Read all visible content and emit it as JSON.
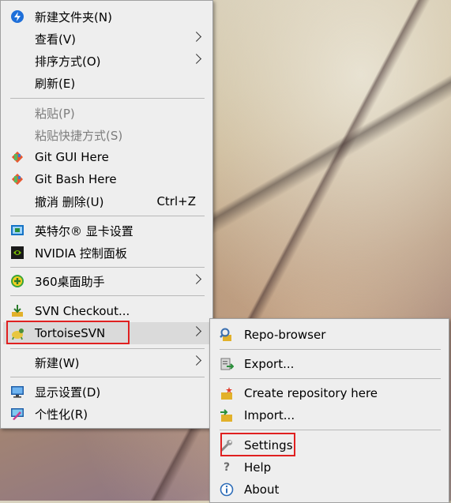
{
  "context_menu": {
    "items": [
      {
        "label": "新建文件夹(N)",
        "icon": "blue-arrow-icon"
      },
      {
        "label": "查看(V)",
        "submenu": true
      },
      {
        "label": "排序方式(O)",
        "submenu": true
      },
      {
        "label": "刷新(E)"
      },
      {
        "label": "粘贴(P)",
        "disabled": true
      },
      {
        "label": "粘贴快捷方式(S)",
        "disabled": true
      },
      {
        "label": "Git GUI Here",
        "icon": "git-icon"
      },
      {
        "label": "Git Bash Here",
        "icon": "git-icon"
      },
      {
        "label": "撤消 删除(U)",
        "shortcut": "Ctrl+Z"
      },
      {
        "label": "英特尔® 显卡设置",
        "icon": "intel-graphics-icon"
      },
      {
        "label": "NVIDIA 控制面板",
        "icon": "nvidia-icon"
      },
      {
        "label": "360桌面助手",
        "icon": "360-icon",
        "submenu": true
      },
      {
        "label": "SVN Checkout...",
        "icon": "svn-checkout-icon"
      },
      {
        "label": "TortoiseSVN",
        "icon": "tortoisesvn-icon",
        "submenu": true
      },
      {
        "label": "新建(W)",
        "submenu": true
      },
      {
        "label": "显示设置(D)",
        "icon": "display-settings-icon"
      },
      {
        "label": "个性化(R)",
        "icon": "personalize-icon"
      }
    ]
  },
  "tortoise_submenu": {
    "items": [
      {
        "label": "Repo-browser",
        "icon": "repo-browser-icon"
      },
      {
        "label": "Export...",
        "icon": "export-icon"
      },
      {
        "label": "Create repository here",
        "icon": "create-repository-icon"
      },
      {
        "label": "Import...",
        "icon": "import-icon"
      },
      {
        "label": "Settings",
        "icon": "wrench-icon"
      },
      {
        "label": "Help",
        "icon": "help-icon"
      },
      {
        "label": "About",
        "icon": "info-icon"
      }
    ]
  },
  "colors": {
    "menu_bg": "#eeeeee",
    "hover_bg": "#dadada",
    "highlight_box": "#e02020",
    "disabled_text": "#7d7d7d"
  }
}
